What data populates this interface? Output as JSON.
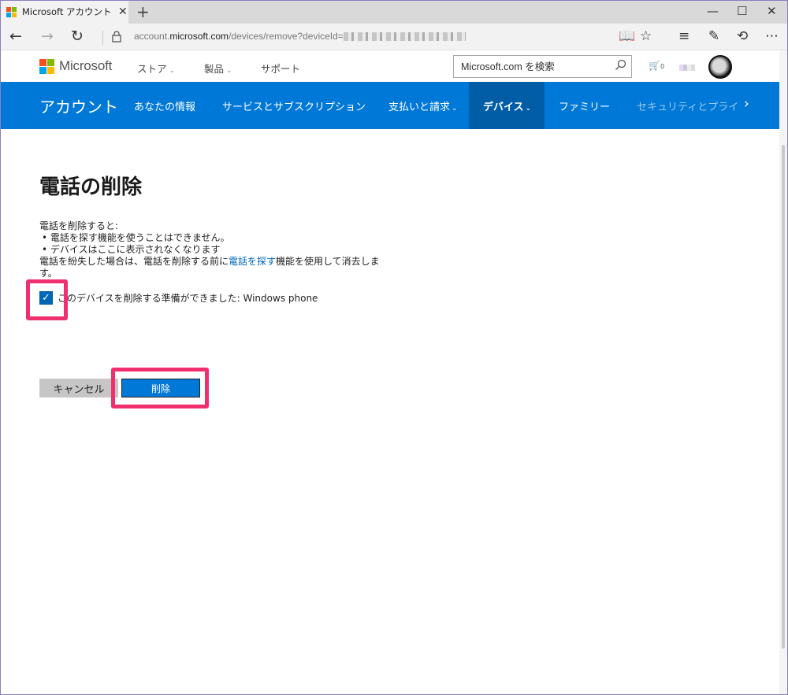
{
  "browser": {
    "tab_title": "Microsoft アカウント | デバ",
    "tab_close": "✕",
    "new_tab": "+",
    "url_prefix": "account.",
    "url_domain": "microsoft.com",
    "url_path": "/devices/remove?deviceId=",
    "win_min": "—",
    "win_max": "☐",
    "win_close": "✕"
  },
  "ms_header": {
    "brand": "Microsoft",
    "nav": [
      {
        "label": "ストア"
      },
      {
        "label": "製品"
      },
      {
        "label": "サポート"
      }
    ],
    "chevron": "⌄",
    "search_placeholder": "Microsoft.com を検索",
    "cart_count": "0"
  },
  "account_nav": {
    "title": "アカウント",
    "items": [
      {
        "label": "あなたの情報"
      },
      {
        "label": "サービスとサブスクリプション"
      },
      {
        "label": "支払いと請求"
      },
      {
        "label": "デバイス"
      },
      {
        "label": "ファミリー"
      },
      {
        "label": "セキュリティとプライ..."
      }
    ],
    "more": "›"
  },
  "page": {
    "title": "電話の削除",
    "desc_intro": "電話を削除すると:",
    "bullets": [
      "•   電話を探す機能を使うことはできません。",
      "•   デバイスはここに表示されなくなります"
    ],
    "desc_before_link": "電話を紛失した場合は、電話を削除する前に",
    "desc_link": "電話を探す",
    "desc_after_link": "機能を使用して消去します。",
    "checkbox_label": "このデバイスを削除する準備ができました: Windows phone",
    "checkbox_checked": true,
    "cancel_label": "キャンセル",
    "delete_label": "削除"
  },
  "colors": {
    "accent_blue": "#0078d7",
    "active_nav": "#005da6",
    "highlight": "#f0306e"
  }
}
